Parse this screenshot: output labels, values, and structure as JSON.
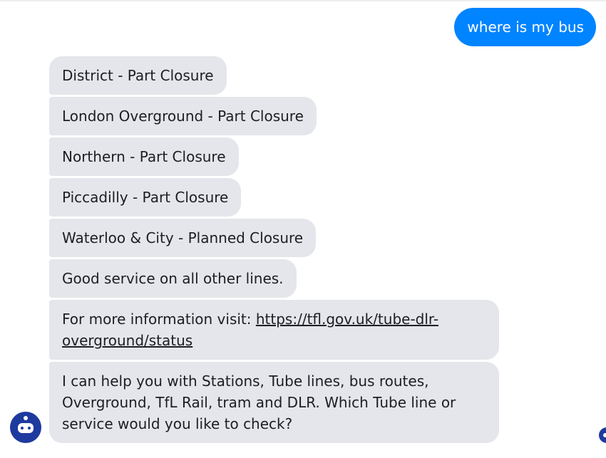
{
  "chat": {
    "user_message": "where is my bus",
    "bot_messages": [
      "District - Part Closure",
      "London Overground - Part Closure",
      "Northern - Part Closure",
      "Piccadilly - Part Closure",
      "Waterloo & City - Planned Closure",
      "Good service on all other lines."
    ],
    "info_prefix": "For more information visit: ",
    "info_link": "https://tfl.gov.uk/tube-dlr-overground/status",
    "help_message": "I can help you with Stations, Tube lines, bus routes, Overground, TfL Rail, tram and DLR. Which Tube line or service would you like to check?"
  },
  "colors": {
    "user_bubble": "#0084ff",
    "bot_bubble": "#e4e6eb",
    "bot_avatar": "#1e3a9e"
  },
  "icons": {
    "bot_avatar": "robot-icon",
    "read_receipt": "robot-icon"
  }
}
